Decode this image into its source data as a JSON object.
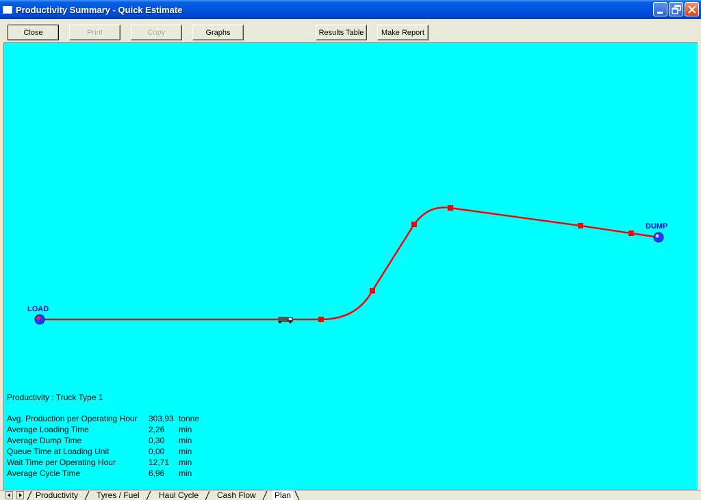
{
  "window": {
    "title": "Productivity Summary - Quick Estimate"
  },
  "toolbar": {
    "close_label": "Close",
    "print_label": "Print",
    "copy_label": "Copy",
    "graphs_label": "Graphs",
    "results_table_label": "Results Table",
    "make_report_label": "Make Report"
  },
  "plan": {
    "background_color": "#00ffff",
    "route_color": "#ff0000",
    "load_label": "LOAD",
    "dump_label": "DUMP"
  },
  "productivity": {
    "title": "Productivity : Truck Type 1",
    "rows": [
      {
        "label": "Avg. Production per Operating Hour",
        "value": "303,93",
        "unit": "tonne"
      },
      {
        "label": "Average Loading Time",
        "value": "2,26",
        "unit": "min"
      },
      {
        "label": "Average Dump Time",
        "value": "0,30",
        "unit": "min"
      },
      {
        "label": "Queue Time at Loading Unit",
        "value": "0,00",
        "unit": "min"
      },
      {
        "label": "Wait Time per Operating Hour",
        "value": "12,71",
        "unit": "min"
      },
      {
        "label": "Average Cycle Time",
        "value": "6,96",
        "unit": "min"
      }
    ]
  },
  "tabs": [
    {
      "label": "Productivity"
    },
    {
      "label": "Tyres / Fuel"
    },
    {
      "label": "Haul Cycle"
    },
    {
      "label": "Cash Flow"
    },
    {
      "label": "Plan"
    }
  ],
  "active_tab": "Plan",
  "icons": {
    "app": "window-app-icon",
    "minimize": "minimize-icon",
    "restore": "restore-icon",
    "close": "close-icon",
    "truck": "truck-icon",
    "site_marker": "site-marker-icon"
  }
}
